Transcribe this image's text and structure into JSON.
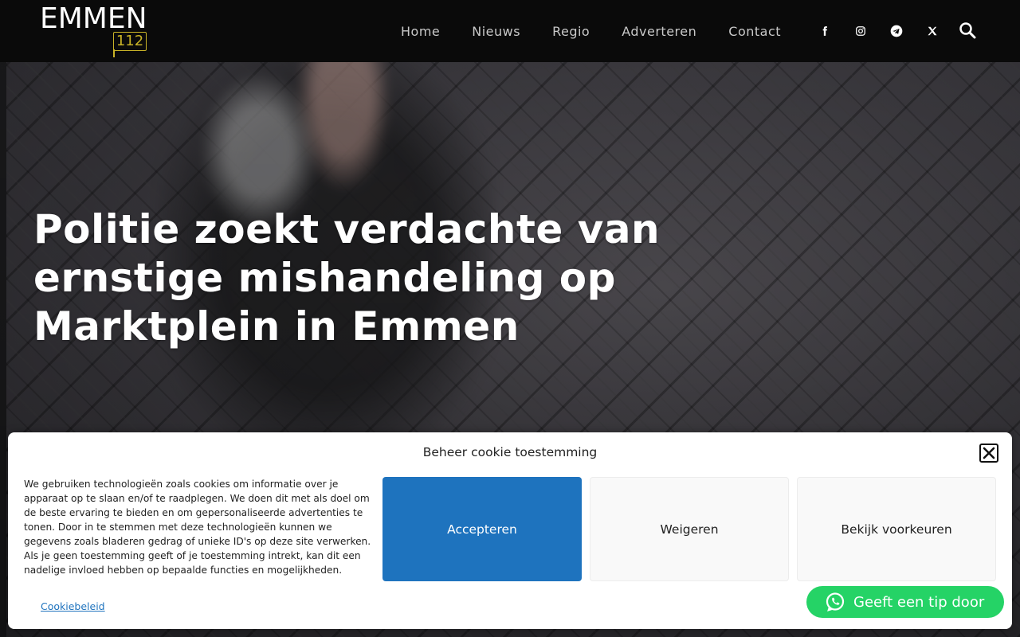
{
  "brand": {
    "name": "EMMEN",
    "number": "112",
    "accent_color": "#c8b227"
  },
  "nav": {
    "items": [
      {
        "label": "Home"
      },
      {
        "label": "Nieuws"
      },
      {
        "label": "Regio"
      },
      {
        "label": "Adverteren"
      },
      {
        "label": "Contact"
      }
    ],
    "socials": [
      "facebook-icon",
      "instagram-icon",
      "telegram-icon",
      "x-icon"
    ],
    "search_icon": "search-icon"
  },
  "article": {
    "title": "Politie zoekt verdachte van ernstige mishandeling op Marktplein in Emmen"
  },
  "cookie_banner": {
    "title": "Beheer cookie toestemming",
    "text": "We gebruiken technologieën zoals cookies om informatie over je apparaat op te slaan en/of te raadplegen. We doen dit met als doel om de beste ervaring te bieden en om gepersonaliseerde advertenties te tonen. Door in te stemmen met deze technologieën kunnen we gegevens zoals bladeren gedrag of unieke ID's op deze site verwerken. Als je geen toestemming geeft of je toestemming intrekt, kan dit een nadelige invloed hebben op bepaalde functies en mogelijkheden.",
    "accept_label": "Accepteren",
    "deny_label": "Weigeren",
    "prefs_label": "Bekijk voorkeuren",
    "policy_link": "Cookiebeleid",
    "accept_color": "#1e73be"
  },
  "tip_button": {
    "label": "Geeft een tip door",
    "color": "#25d366",
    "icon": "whatsapp-icon"
  }
}
